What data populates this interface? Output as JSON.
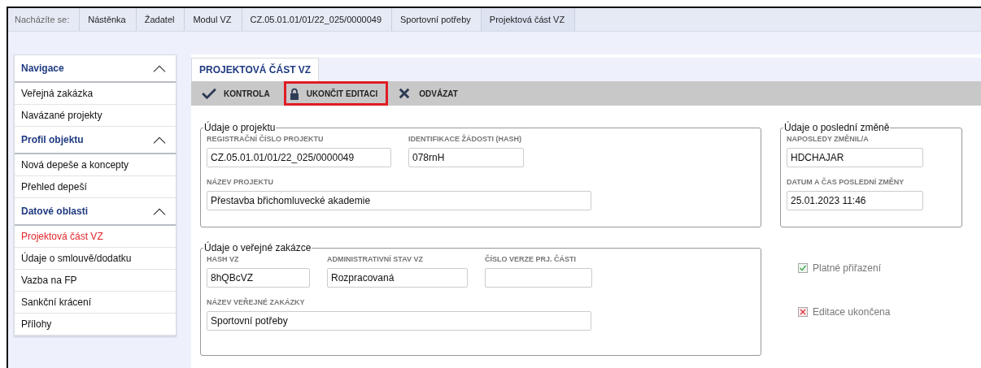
{
  "breadcrumb": {
    "label": "Nacházíte se:",
    "items": [
      "Nástěnka",
      "Žadatel",
      "Modul VZ",
      "CZ.05.01.01/01/22_025/0000049",
      "Sportovní potřeby",
      "Projektová část VZ"
    ]
  },
  "sidebar": {
    "sections": [
      {
        "title": "Navigace",
        "expanded": true,
        "items": [
          {
            "label": "Veřejná zakázka",
            "selected": false
          },
          {
            "label": "Navázané projekty",
            "selected": false
          }
        ]
      },
      {
        "title": "Profil objektu",
        "expanded": true,
        "items": [
          {
            "label": "Nová depeše a koncepty",
            "selected": false
          },
          {
            "label": "Přehled depeší",
            "selected": false
          }
        ]
      },
      {
        "title": "Datové oblasti",
        "expanded": true,
        "items": [
          {
            "label": "Projektová část VZ",
            "selected": true
          },
          {
            "label": "Údaje o smlouvě/dodatku",
            "selected": false
          },
          {
            "label": "Vazba na FP",
            "selected": false
          },
          {
            "label": "Sankční krácení",
            "selected": false
          },
          {
            "label": "Přílohy",
            "selected": false
          }
        ]
      }
    ]
  },
  "tab": {
    "label": "PROJEKTOVÁ ČÁST VZ"
  },
  "toolbar": [
    {
      "kind": "check",
      "label": "KONTROLA",
      "highlighted": false
    },
    {
      "kind": "lock",
      "label": "UKONČIT EDITACI",
      "highlighted": true
    },
    {
      "kind": "cross",
      "label": "ODVÁZAT",
      "highlighted": false
    }
  ],
  "fieldsets": [
    {
      "legend": "Údaje o projektu",
      "rows": [
        [
          {
            "label": "REGISTRAČNÍ ČÍSLO PROJEKTU",
            "value": "CZ.05.01.01/01/22_025/0000049"
          },
          {
            "label": "IDENTIFIKACE ŽÁDOSTI (HASH)",
            "value": "078rnH"
          }
        ],
        [
          {
            "label": "NÁZEV PROJEKTU",
            "value": "Přestavba břichomluvecké akademie"
          }
        ]
      ]
    },
    {
      "legend": "Údaje o poslední změně",
      "rows": [
        [
          {
            "label": "NAPOSLEDY ZMĚNIL/A",
            "value": "HDCHAJAR"
          }
        ],
        [
          {
            "label": "DATUM A ČAS POSLEDNÍ ZMĚNY",
            "value": "25.01.2023 11:46"
          }
        ]
      ]
    },
    {
      "legend": "Údaje o veřejné zakázce",
      "rows": [
        [
          {
            "label": "HASH VZ",
            "value": "8hQBcVZ"
          },
          {
            "label": "ADMINISTRATIVNÍ STAV VZ",
            "value": "Rozpracovaná"
          },
          {
            "label": "ČÍSLO VERZE PRJ. ČÁSTI"
          }
        ],
        [
          {
            "label": "NÁZEV VEŘEJNÉ ZAKÁZKY",
            "value": "Sportovní potřeby"
          }
        ]
      ]
    }
  ],
  "flags": [
    {
      "label": "Platné přiřazení",
      "checked": true
    },
    {
      "label": "Editace ukončena",
      "checked": false
    }
  ]
}
